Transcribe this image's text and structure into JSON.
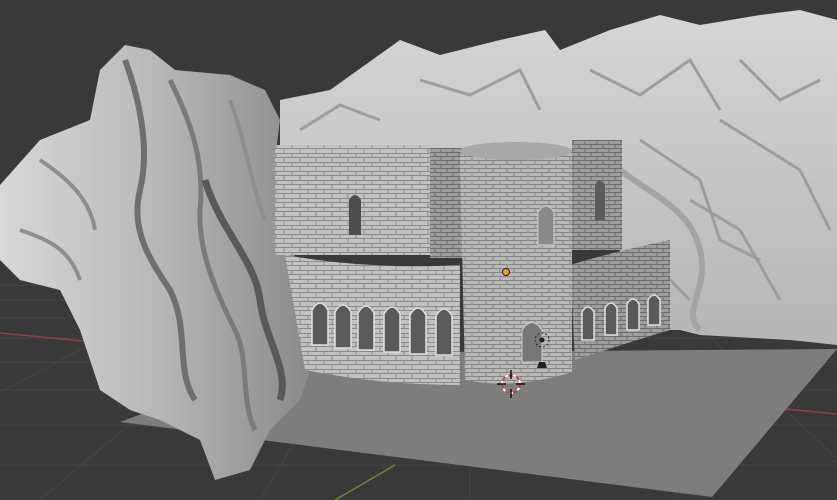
{
  "viewport": {
    "background": "#393939",
    "grid_color": "#454545",
    "x_axis_color": "#9b3a44",
    "y_axis_color": "#6a8b2e"
  },
  "scene": {
    "ground_plane_color": "#7d7d7d",
    "rock_color": "#c9c9c9",
    "castle_color": "#bdbdbd",
    "selection_origin_color": "#f29a2b",
    "cursor_icon": "3d-cursor-icon",
    "origin_icon": "object-origin-icon",
    "light_icon": "light-gizmo-icon",
    "camera_icon": "camera-gizmo-icon"
  }
}
